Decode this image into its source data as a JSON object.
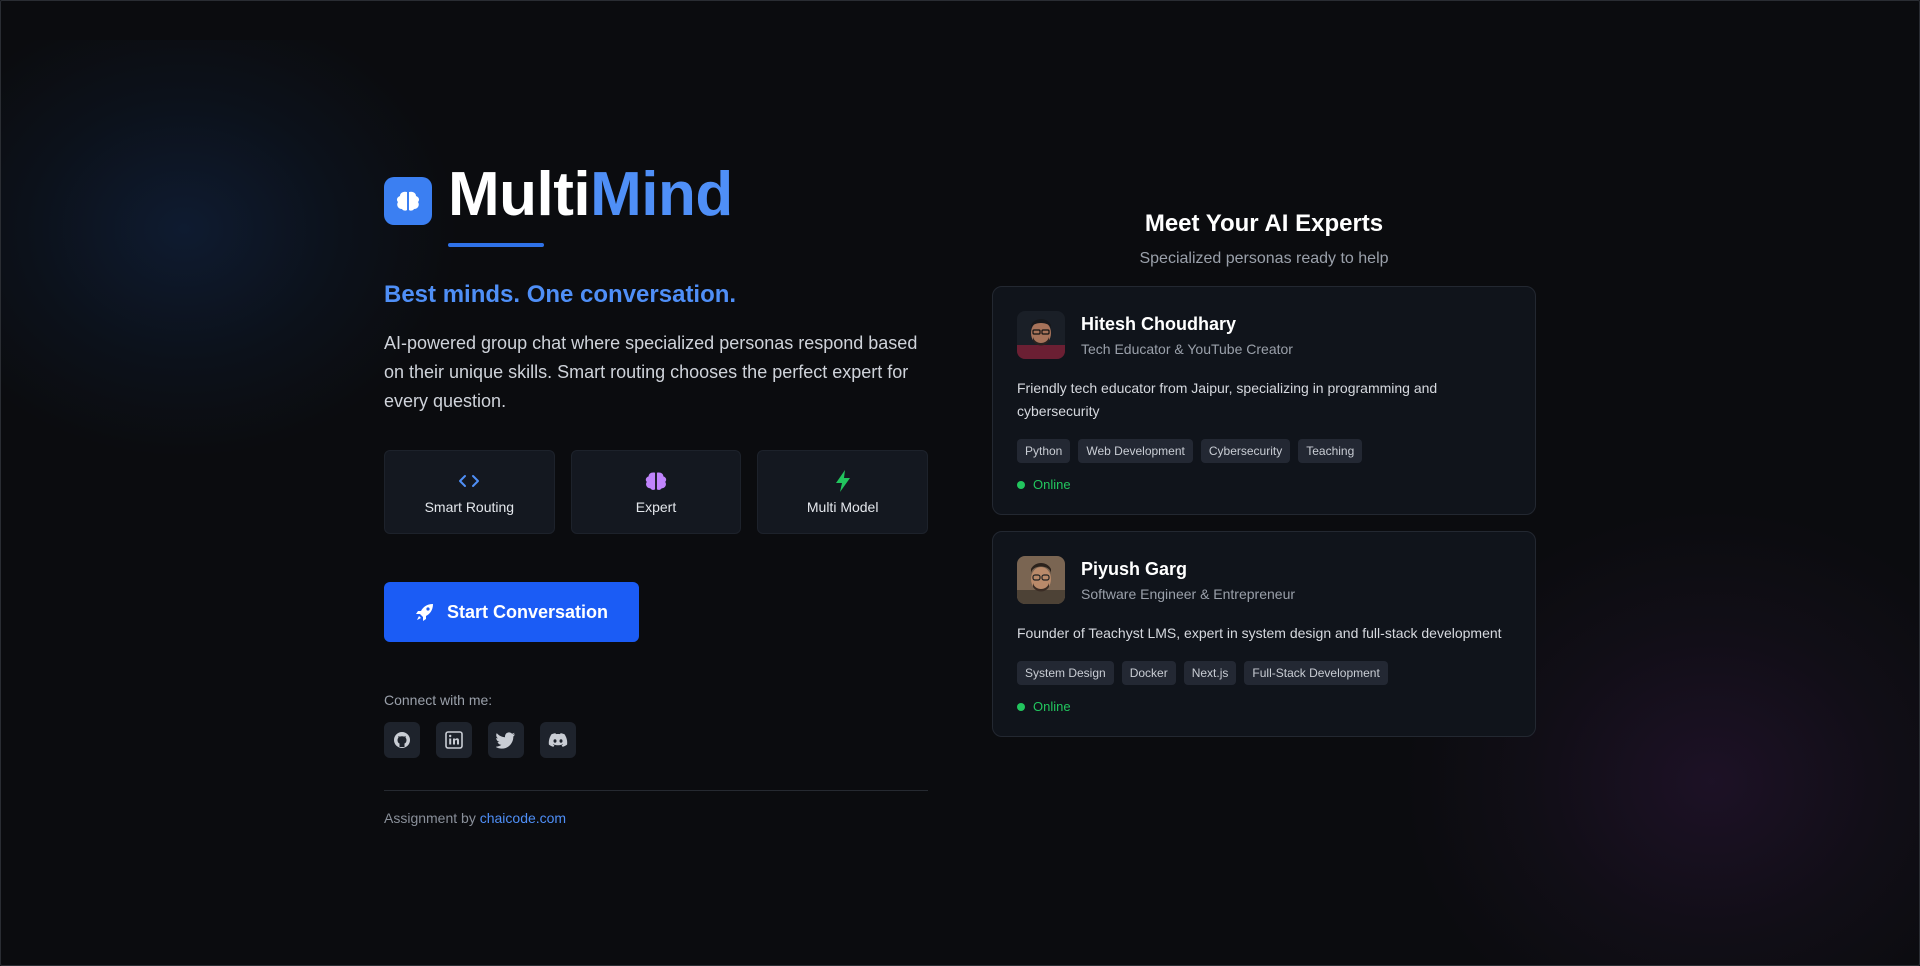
{
  "brand": {
    "name_part1": "Multi",
    "name_part2": "Mind",
    "icon": "brain-icon"
  },
  "hero": {
    "tagline": "Best minds. One conversation.",
    "description": "AI-powered group chat where specialized personas respond based on their unique skills. Smart routing chooses the perfect expert for every question."
  },
  "features": [
    {
      "label": "Smart Routing",
      "icon": "code-icon",
      "color": "#4f8ff7"
    },
    {
      "label": "Expert",
      "icon": "brain-icon",
      "color": "#c084fc"
    },
    {
      "label": "Multi Model",
      "icon": "bolt-icon",
      "color": "#22c55e"
    }
  ],
  "cta": {
    "label": "Start Conversation",
    "icon": "rocket-icon"
  },
  "connect": {
    "title": "Connect with me:",
    "socials": [
      "github-icon",
      "linkedin-icon",
      "twitter-icon",
      "discord-icon"
    ]
  },
  "footer": {
    "prefix": "Assignment by",
    "link_text": "chaicode.com"
  },
  "experts": {
    "title": "Meet Your AI Experts",
    "subtitle": "Specialized personas ready to help",
    "cards": [
      {
        "name": "Hitesh Choudhary",
        "role": "Tech Educator & YouTube Creator",
        "bio": "Friendly tech educator from Jaipur, specializing in programming and cybersecurity",
        "tags": [
          "Python",
          "Web Development",
          "Cybersecurity",
          "Teaching"
        ],
        "status": "Online"
      },
      {
        "name": "Piyush Garg",
        "role": "Software Engineer & Entrepreneur",
        "bio": "Founder of Teachyst LMS, expert in system design and full-stack development",
        "tags": [
          "System Design",
          "Docker",
          "Next.js",
          "Full-Stack Development"
        ],
        "status": "Online"
      }
    ]
  },
  "colors": {
    "accent": "#4f8ff7",
    "button": "#1b5cf5",
    "online": "#22c55e"
  }
}
